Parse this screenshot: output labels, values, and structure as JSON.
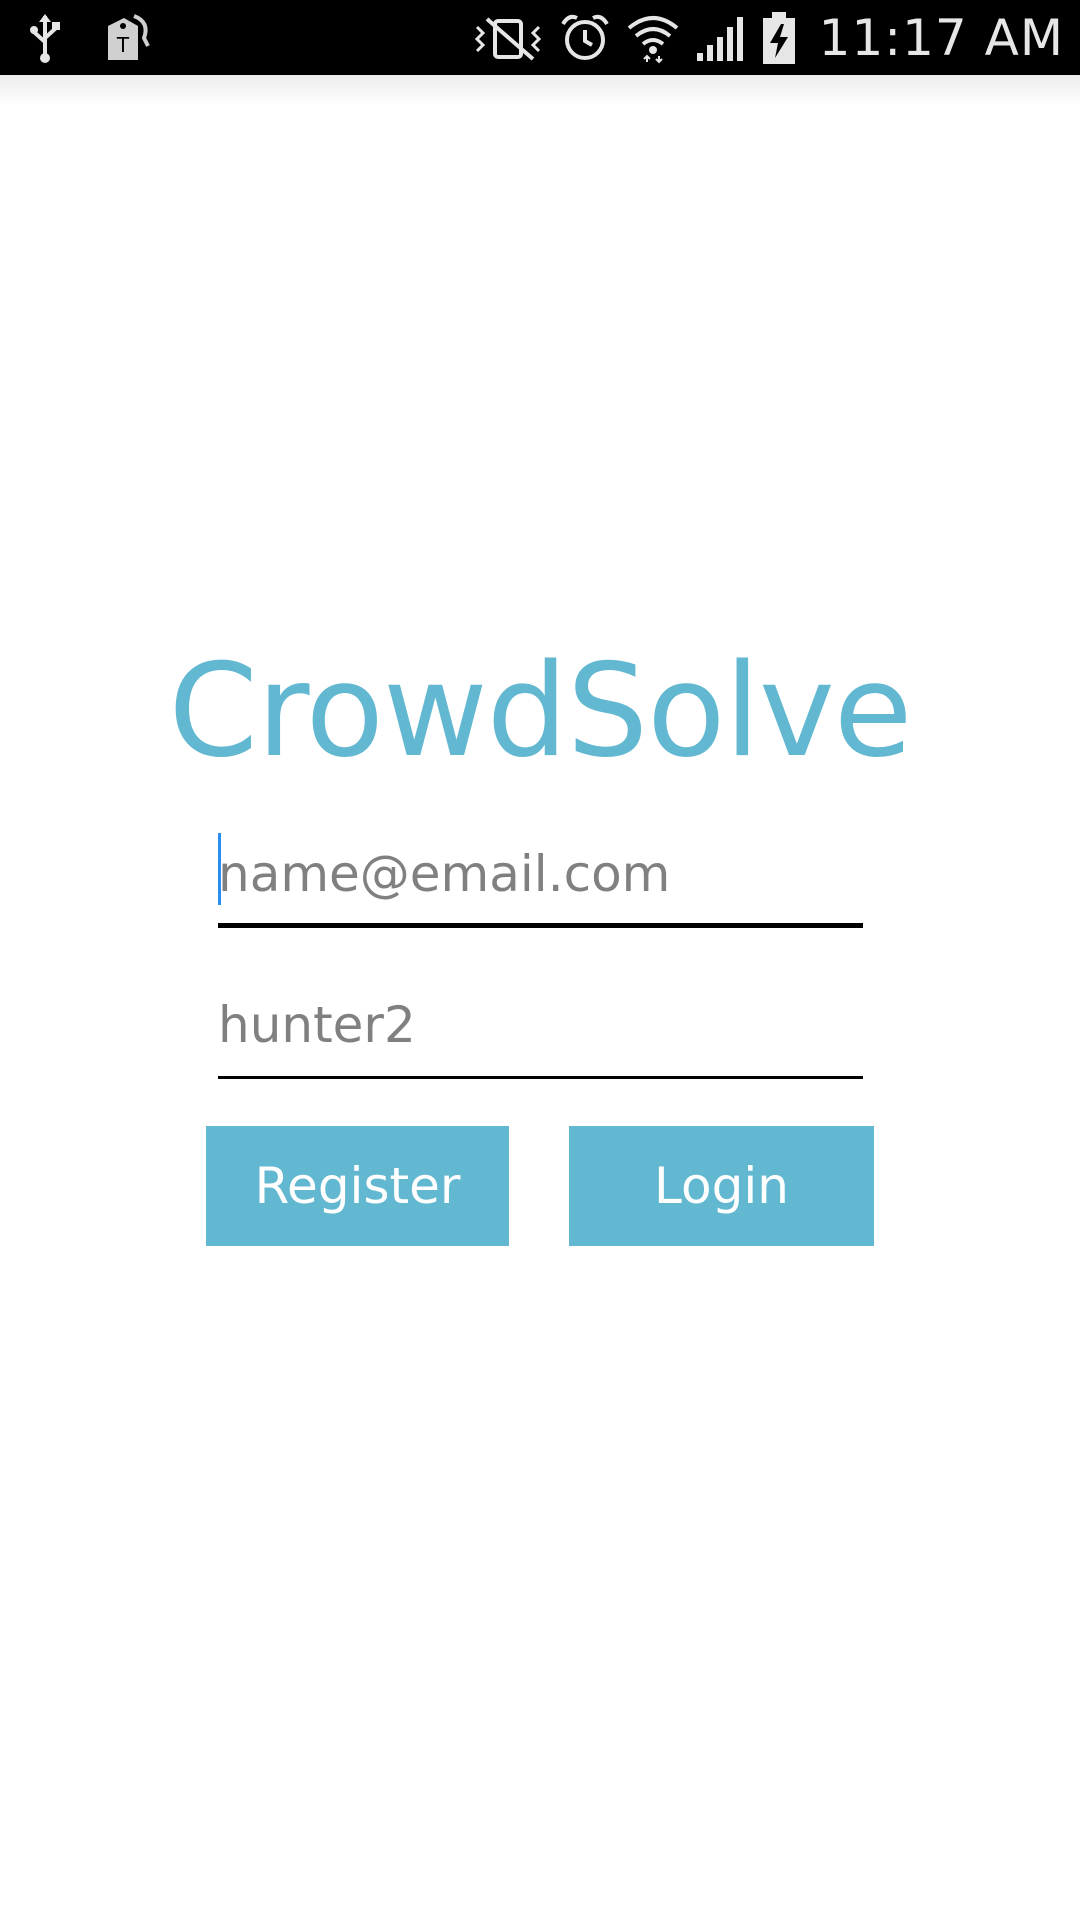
{
  "status_bar": {
    "time": "11:17 AM",
    "icons_left": [
      "usb-icon",
      "tmobile-tag-icon"
    ],
    "icons_right": [
      "vibrate-mute-icon",
      "alarm-icon",
      "wifi-icon",
      "signal-icon",
      "battery-charging-icon"
    ]
  },
  "app": {
    "title": "CrowdSolve"
  },
  "form": {
    "email_value": "name@email.com",
    "password_value": "hunter2"
  },
  "buttons": {
    "register_label": "Register",
    "login_label": "Login"
  },
  "colors": {
    "accent": "#62b8d0",
    "status_bar": "#000000",
    "cursor": "#2a8df0",
    "input_text": "#808080"
  }
}
